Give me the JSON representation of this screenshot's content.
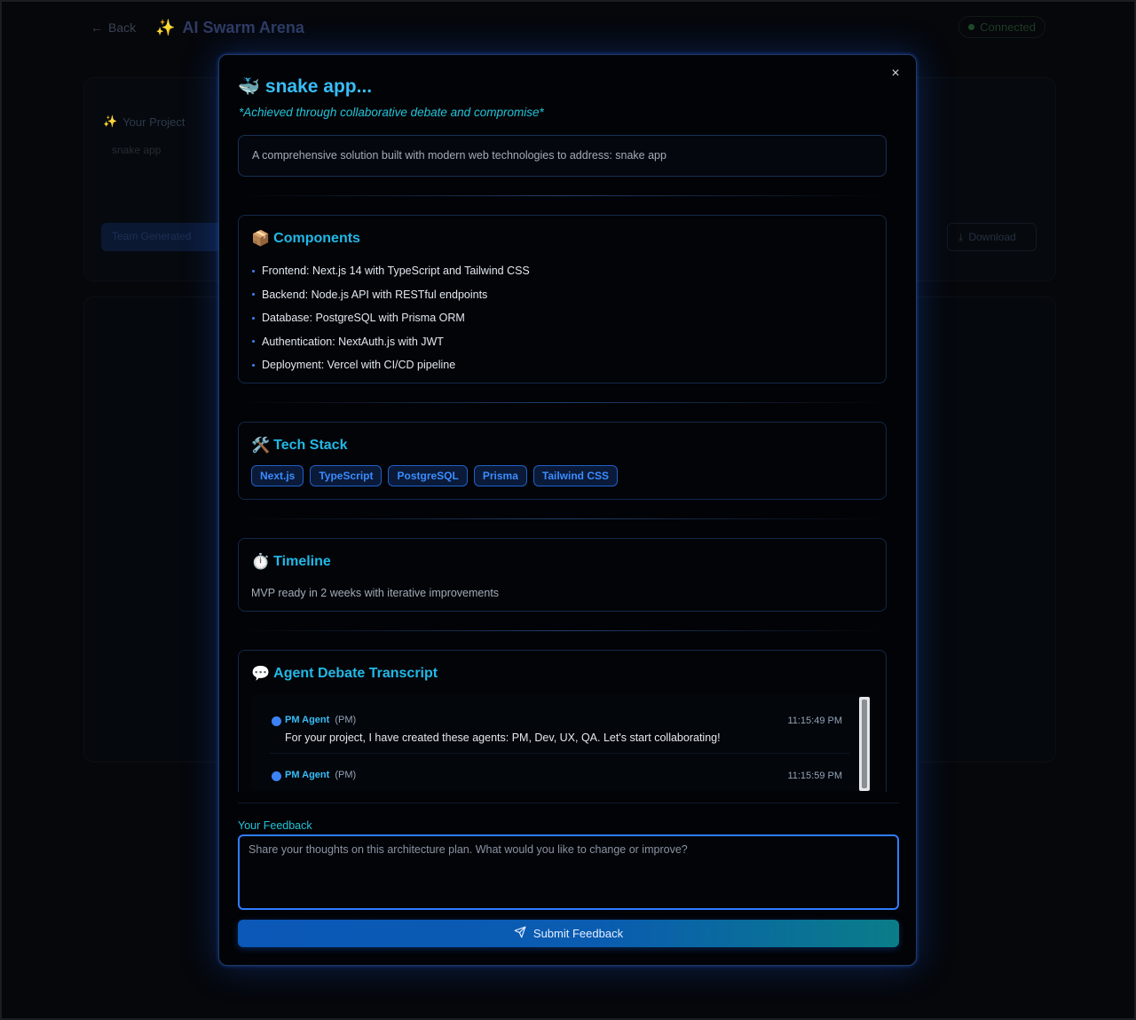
{
  "background": {
    "back_label": "Back",
    "app_title": "AI Swarm Arena",
    "status": "Connected",
    "project_label": "Your Project",
    "project_value": "snake app",
    "team_button": "Team Generated",
    "download_button": "Download"
  },
  "modal": {
    "title_emoji": "🐳",
    "title": "snake app...",
    "subtitle": "*Achieved through collaborative debate and compromise*",
    "description": "A comprehensive solution built with modern web technologies to address: snake app",
    "close": "×",
    "components": {
      "emoji": "📦",
      "title": "Components",
      "items": [
        "Frontend: Next.js 14 with TypeScript and Tailwind CSS",
        "Backend: Node.js API with RESTful endpoints",
        "Database: PostgreSQL with Prisma ORM",
        "Authentication: NextAuth.js with JWT",
        "Deployment: Vercel with CI/CD pipeline"
      ]
    },
    "tech_stack": {
      "emoji": "🛠️",
      "title": "Tech Stack",
      "tags": [
        "Next.js",
        "TypeScript",
        "PostgreSQL",
        "Prisma",
        "Tailwind CSS"
      ]
    },
    "timeline": {
      "emoji": "⏱️",
      "title": "Timeline",
      "text": "MVP ready in 2 weeks with iterative improvements"
    },
    "transcript": {
      "emoji": "💬",
      "title": "Agent Debate Transcript",
      "messages": [
        {
          "agent": "PM Agent",
          "role": "(PM)",
          "time": "11:15:49 PM",
          "text": "For your project, I have created these agents: PM, Dev, UX, QA. Let's start collaborating!"
        },
        {
          "agent": "PM Agent",
          "role": "(PM)",
          "time": "11:15:59 PM",
          "text": ""
        }
      ]
    },
    "feedback": {
      "label": "Your Feedback",
      "placeholder": "Share your thoughts on this architecture plan. What would you like to change or improve?",
      "submit": "Submit Feedback"
    }
  }
}
